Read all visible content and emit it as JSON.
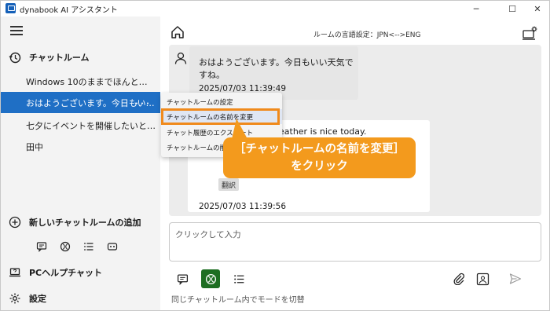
{
  "window": {
    "title": "dynabook AI アシスタント",
    "min_icon": "─",
    "max_icon": "☐",
    "close_icon": "✕"
  },
  "sidebar": {
    "chatroom_header": "チャットルーム",
    "rooms": [
      {
        "label": "Windows 10のままでほんと…",
        "active": false
      },
      {
        "label": "おはようございます。今日もい…",
        "active": true,
        "more": "･･･"
      },
      {
        "label": "七夕にイベントを開催したいと…",
        "active": false
      },
      {
        "label": "田中",
        "active": false
      }
    ],
    "add_room": "新しいチャットルームの追加",
    "pc_help": "PCヘルプチャット",
    "settings": "設定"
  },
  "topbar": {
    "language_setting": "ルームの言語設定：JPN<-->ENG"
  },
  "chat": {
    "user_message": "おはようございます。今日もいい天気ですね。",
    "user_time": "2025/07/03 11:39:49",
    "ai_message": "weather is nice today.",
    "ai_button": "翻訳",
    "ai_time": "2025/07/03 11:39:56"
  },
  "input": {
    "placeholder": "クリックして入力",
    "mode_hint": "同じチャットルーム内でモードを切替"
  },
  "context_menu": {
    "items": [
      "チャットルームの設定",
      "チャットルームの名前を変更",
      "チャット履歴のエクスポート",
      "チャットルームの削除"
    ],
    "highlighted_index": 1
  },
  "callout": {
    "line1": "［チャットルームの名前を変更］",
    "line2": "をクリック"
  },
  "colors": {
    "accent_blue": "#1f6fc5",
    "active_mode_green": "#1e6e22",
    "callout_orange": "#f39a1d"
  }
}
